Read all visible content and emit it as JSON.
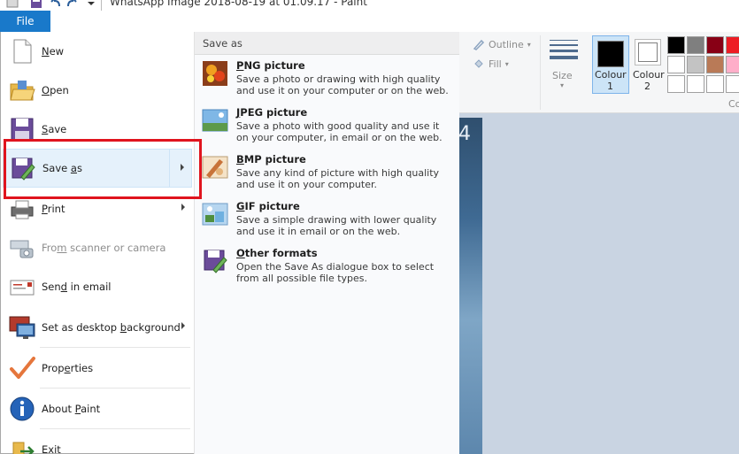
{
  "window": {
    "title": "WhatsApp Image 2018-08-19 at 01.09.17 - Paint"
  },
  "ribbon": {
    "file_tab": "File",
    "outline_label": "Outline",
    "fill_label": "Fill",
    "size_label": "Size",
    "colour1_label": "Colour\n1",
    "colour1_line1": "Colour",
    "colour1_line2": "1",
    "colour2_line1": "Colour",
    "colour2_line2": "2",
    "colours_group_label": "Co",
    "palette": [
      "#000000",
      "#7f7f7f",
      "#880015",
      "#ed1c24",
      "#ffffff",
      "#c3c3c3",
      "#b97a57",
      "#ffaec9",
      "#ffffff",
      "#ffffff",
      "#ffffff",
      "#ffffff"
    ]
  },
  "canvas": {
    "visible_text": "4"
  },
  "file_menu": {
    "items": [
      {
        "label": "New",
        "accel": "N",
        "rest": "ew"
      },
      {
        "label": "Open",
        "accel": "O",
        "rest": "pen"
      },
      {
        "label": "Save",
        "accel": "S",
        "rest": "ave"
      },
      {
        "label": "Save as",
        "pre": "Save ",
        "accel": "a",
        "rest": "s"
      },
      {
        "label": "Print",
        "accel": "P",
        "rest": "rint"
      },
      {
        "label": "From scanner or camera",
        "pre": "Fro",
        "accel": "m",
        "rest": " scanner or camera"
      },
      {
        "label": "Send in email",
        "pre": "Sen",
        "accel": "d",
        "rest": " in email"
      },
      {
        "label": "Set as desktop background",
        "pre": "Set as desktop ",
        "accel": "b",
        "rest": "ackground"
      },
      {
        "label": "Properties",
        "pre": "Prop",
        "accel": "e",
        "rest": "rties"
      },
      {
        "label": "About Paint",
        "pre": "About ",
        "accel": "P",
        "rest": "aint"
      },
      {
        "label": "Exit",
        "pre": "E",
        "accel": "x",
        "rest": "it"
      }
    ]
  },
  "save_as_panel": {
    "header": "Save as",
    "options": [
      {
        "accel": "P",
        "rest": "NG picture",
        "desc": "Save a photo or drawing with high quality and use it on your computer or on the web."
      },
      {
        "accel": "J",
        "rest": "PEG picture",
        "desc": "Save a photo with good quality and use it on your computer, in email or on the web."
      },
      {
        "accel": "B",
        "rest": "MP picture",
        "desc": "Save any kind of picture with high quality and use it on your computer."
      },
      {
        "accel": "G",
        "rest": "IF picture",
        "desc": "Save a simple drawing with lower quality and use it in email or on the web."
      },
      {
        "accel": "O",
        "rest": "ther formats",
        "desc": "Open the Save As dialogue box to select from all possible file types."
      }
    ]
  },
  "colors": {
    "file_tab": "#1979ca",
    "highlight": "#e0141e",
    "selected_row": "#e5f1fb"
  }
}
